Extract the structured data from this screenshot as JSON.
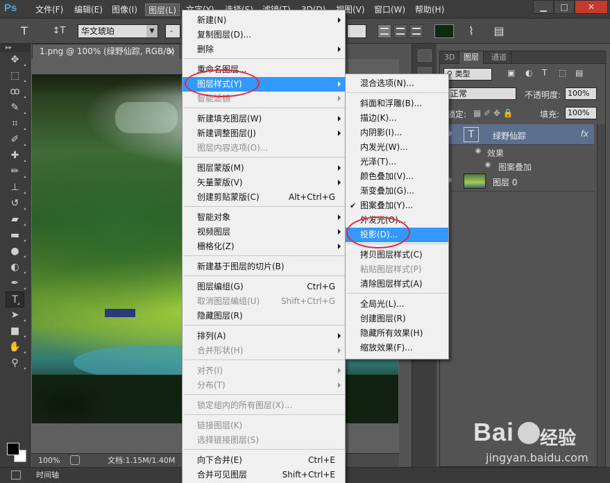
{
  "app": {
    "logo": "Ps",
    "menus": [
      {
        "label": "文件(F)"
      },
      {
        "label": "编辑(E)"
      },
      {
        "label": "图像(I)"
      },
      {
        "label": "图层(L)"
      },
      {
        "label": "文字(Y)"
      },
      {
        "label": "选择(S)"
      },
      {
        "label": "滤镜(T)"
      },
      {
        "label": "3D(D)"
      },
      {
        "label": "视图(V)"
      },
      {
        "label": "窗口(W)"
      },
      {
        "label": "帮助(H)"
      }
    ],
    "window_buttons": {
      "minimize": "▁",
      "maximize": "□",
      "close": "✕"
    }
  },
  "options_bar": {
    "tool_glyph": "T",
    "orientation_glyph": "↕T",
    "font_family": "华文琥珀",
    "font_style_placeholder": "-"
  },
  "toolbox": {
    "tools": [
      {
        "name": "move-tool",
        "glyph": "✥"
      },
      {
        "name": "marquee-tool",
        "glyph": "⬚"
      },
      {
        "name": "lasso-tool",
        "glyph": "ꝏ"
      },
      {
        "name": "quick-select-tool",
        "glyph": "✎"
      },
      {
        "name": "crop-tool",
        "glyph": "⌗"
      },
      {
        "name": "eyedropper-tool",
        "glyph": "✐"
      },
      {
        "name": "healing-tool",
        "glyph": "✚"
      },
      {
        "name": "brush-tool",
        "glyph": "✏"
      },
      {
        "name": "stamp-tool",
        "glyph": "⊥"
      },
      {
        "name": "history-brush-tool",
        "glyph": "↺"
      },
      {
        "name": "eraser-tool",
        "glyph": "▰"
      },
      {
        "name": "gradient-tool",
        "glyph": "▬"
      },
      {
        "name": "blur-tool",
        "glyph": "●"
      },
      {
        "name": "dodge-tool",
        "glyph": "◐"
      },
      {
        "name": "pen-tool",
        "glyph": "✒"
      },
      {
        "name": "type-tool",
        "glyph": "T"
      },
      {
        "name": "path-select-tool",
        "glyph": "➤"
      },
      {
        "name": "shape-tool",
        "glyph": "■"
      },
      {
        "name": "hand-tool",
        "glyph": "✋"
      },
      {
        "name": "zoom-tool",
        "glyph": "⚲"
      }
    ],
    "selected_tool": "type-tool",
    "foreground_color": "#000000",
    "background_color": "#ffffff"
  },
  "document": {
    "tab_title": "1.png @ 100% (绿野仙踪, RGB/8) *",
    "close_glyph": "×",
    "zoom": "100%",
    "doc_info": "文档:1.15M/1.40M"
  },
  "timeline": {
    "label": "时间轴"
  },
  "layers_panel": {
    "tabs": [
      {
        "label": "3D",
        "active": false
      },
      {
        "label": "图层",
        "active": true
      },
      {
        "label": "通道",
        "active": false
      }
    ],
    "filter_kind": "类型",
    "blend_mode": "正常",
    "opacity_label": "不透明度:",
    "opacity_value": "100%",
    "lock_label": "锁定:",
    "fill_label": "填充:",
    "fill_value": "100%",
    "layers": [
      {
        "name": "绿野仙踪",
        "type": "text",
        "thumb_glyph": "T",
        "fx": "fx",
        "selected": true
      },
      {
        "name": "效果",
        "type": "effects-group"
      },
      {
        "name": "图案叠加",
        "type": "effect"
      },
      {
        "name": "图层 0",
        "type": "image",
        "selected": false
      }
    ]
  },
  "layer_menu": {
    "items": [
      {
        "label": "新建(N)",
        "submenu": true
      },
      {
        "label": "复制图层(D)..."
      },
      {
        "label": "删除",
        "submenu": true
      },
      {
        "sep": true
      },
      {
        "label": "重命名图层..."
      },
      {
        "label": "图层样式(Y)",
        "submenu": true,
        "highlighted": true
      },
      {
        "label": "智能滤镜",
        "submenu": true,
        "disabled": true
      },
      {
        "sep": true
      },
      {
        "label": "新建填充图层(W)",
        "submenu": true
      },
      {
        "label": "新建调整图层(J)",
        "submenu": true
      },
      {
        "label": "图层内容选项(O)...",
        "disabled": true
      },
      {
        "sep": true
      },
      {
        "label": "图层蒙版(M)",
        "submenu": true
      },
      {
        "label": "矢量蒙版(V)",
        "submenu": true
      },
      {
        "label": "创建剪贴蒙版(C)",
        "shortcut": "Alt+Ctrl+G"
      },
      {
        "sep": true
      },
      {
        "label": "智能对象",
        "submenu": true
      },
      {
        "label": "视频图层",
        "submenu": true
      },
      {
        "label": "栅格化(Z)",
        "submenu": true
      },
      {
        "sep": true
      },
      {
        "label": "新建基于图层的切片(B)"
      },
      {
        "sep": true
      },
      {
        "label": "图层编组(G)",
        "shortcut": "Ctrl+G"
      },
      {
        "label": "取消图层编组(U)",
        "shortcut": "Shift+Ctrl+G",
        "disabled": true
      },
      {
        "label": "隐藏图层(R)"
      },
      {
        "sep": true
      },
      {
        "label": "排列(A)",
        "submenu": true
      },
      {
        "label": "合并形状(H)",
        "submenu": true,
        "disabled": true
      },
      {
        "sep": true
      },
      {
        "label": "对齐(I)",
        "submenu": true,
        "disabled": true
      },
      {
        "label": "分布(T)",
        "submenu": true,
        "disabled": true
      },
      {
        "sep": true
      },
      {
        "label": "锁定组内的所有图层(X)...",
        "disabled": true
      },
      {
        "sep": true
      },
      {
        "label": "链接图层(K)",
        "disabled": true
      },
      {
        "label": "选择链接图层(S)",
        "disabled": true
      },
      {
        "sep": true
      },
      {
        "label": "向下合并(E)",
        "shortcut": "Ctrl+E"
      },
      {
        "label": "合并可见图层",
        "shortcut": "Shift+Ctrl+E"
      }
    ]
  },
  "style_submenu": {
    "items": [
      {
        "label": "混合选项(N)..."
      },
      {
        "sep": true
      },
      {
        "label": "斜面和浮雕(B)..."
      },
      {
        "label": "描边(K)..."
      },
      {
        "label": "内阴影(I)..."
      },
      {
        "label": "内发光(W)..."
      },
      {
        "label": "光泽(T)..."
      },
      {
        "label": "颜色叠加(V)..."
      },
      {
        "label": "渐变叠加(G)..."
      },
      {
        "label": "图案叠加(Y)...",
        "checked": true
      },
      {
        "label": "外发光(O)..."
      },
      {
        "label": "投影(D)...",
        "highlighted": true
      },
      {
        "sep": true
      },
      {
        "label": "拷贝图层样式(C)"
      },
      {
        "label": "粘贴图层样式(P)",
        "disabled": true
      },
      {
        "label": "清除图层样式(A)"
      },
      {
        "sep": true
      },
      {
        "label": "全局光(L)..."
      },
      {
        "label": "创建图层(R)"
      },
      {
        "label": "隐藏所有效果(H)"
      },
      {
        "label": "缩放效果(F)..."
      }
    ]
  },
  "watermark": {
    "brand": "Bai",
    "brand_suffix": "经验",
    "url": "jingyan.baidu.com"
  },
  "colors": {
    "highlight": "#3399ff",
    "annotation": "#e8243a"
  }
}
